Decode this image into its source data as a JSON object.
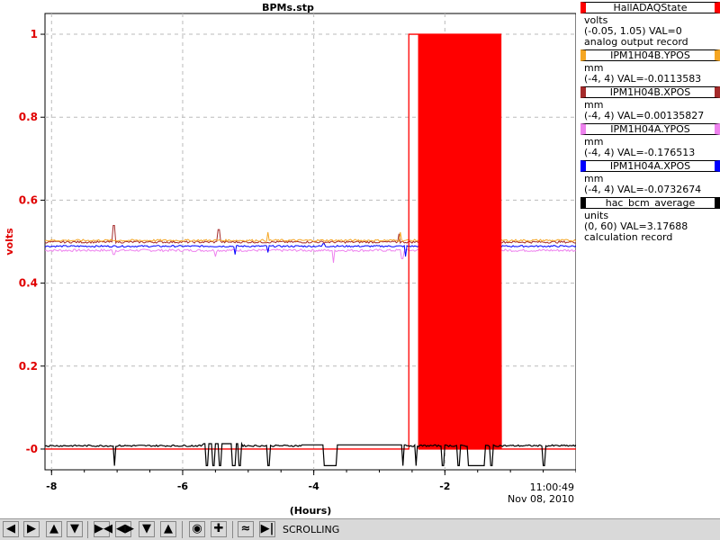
{
  "chart_data": {
    "type": "line",
    "title": "BPMs.stp",
    "xlabel": "(Hours)",
    "ylabel": "volts",
    "xlim": [
      -8.1,
      0.0
    ],
    "ylim": [
      -0.05,
      1.05
    ],
    "x_ticks": [
      -8,
      -6,
      -4,
      -2
    ],
    "x_tick_labels": [
      "-8",
      "-6",
      "-4",
      "-2"
    ],
    "y_ticks": [
      0,
      0.2,
      0.4,
      0.6,
      0.8,
      1
    ],
    "y_tick_labels": [
      "-0",
      "0.2",
      "0.4",
      "0.6",
      "0.8",
      "1"
    ],
    "grid": true,
    "time_label": "11:00:49",
    "date_label": "Nov 08, 2010",
    "series": [
      {
        "name": "HallADAQState",
        "color": "#ff0000",
        "unit": "volts",
        "range": "(-0.05, 1.05)",
        "val": "VAL=0",
        "record": "analog output record",
        "baseline": 0,
        "high": 1
      },
      {
        "name": "IPM1H04B.YPOS",
        "color": "#f5a623",
        "unit": "mm",
        "range": "(-4, 4)",
        "val": "VAL=-0.0113583",
        "baseline": 0.503
      },
      {
        "name": "IPM1H04B.XPOS",
        "color": "#a52a2a",
        "unit": "mm",
        "range": "(-4, 4)",
        "val": "VAL=0.00135827",
        "baseline": 0.499
      },
      {
        "name": "IPM1H04A.YPOS",
        "color": "#ee82ee",
        "unit": "mm",
        "range": "(-4, 4)",
        "val": "VAL=-0.176513",
        "baseline": 0.479
      },
      {
        "name": "IPM1H04A.XPOS",
        "color": "#0000ff",
        "unit": "mm",
        "range": "(-4, 4)",
        "val": "VAL=-0.0732674",
        "baseline": 0.489
      },
      {
        "name": "hac_bcm_average",
        "color": "#000000",
        "unit": "units",
        "range": "(0, 60)",
        "val": "VAL=3.17688",
        "record": "calculation record",
        "baseline": 0.008
      }
    ]
  },
  "toolbar": {
    "mode": "SCROLLING",
    "buttons": [
      "arrow-left-icon",
      "arrow-right-icon",
      "arrow-up-icon",
      "arrow-down-icon",
      "zoom-in-x-icon",
      "zoom-out-x-icon",
      "zoom-in-y-icon",
      "zoom-out-y-icon",
      "record-icon",
      "crosshair-icon",
      "autoscale-icon",
      "skip-icon"
    ]
  }
}
